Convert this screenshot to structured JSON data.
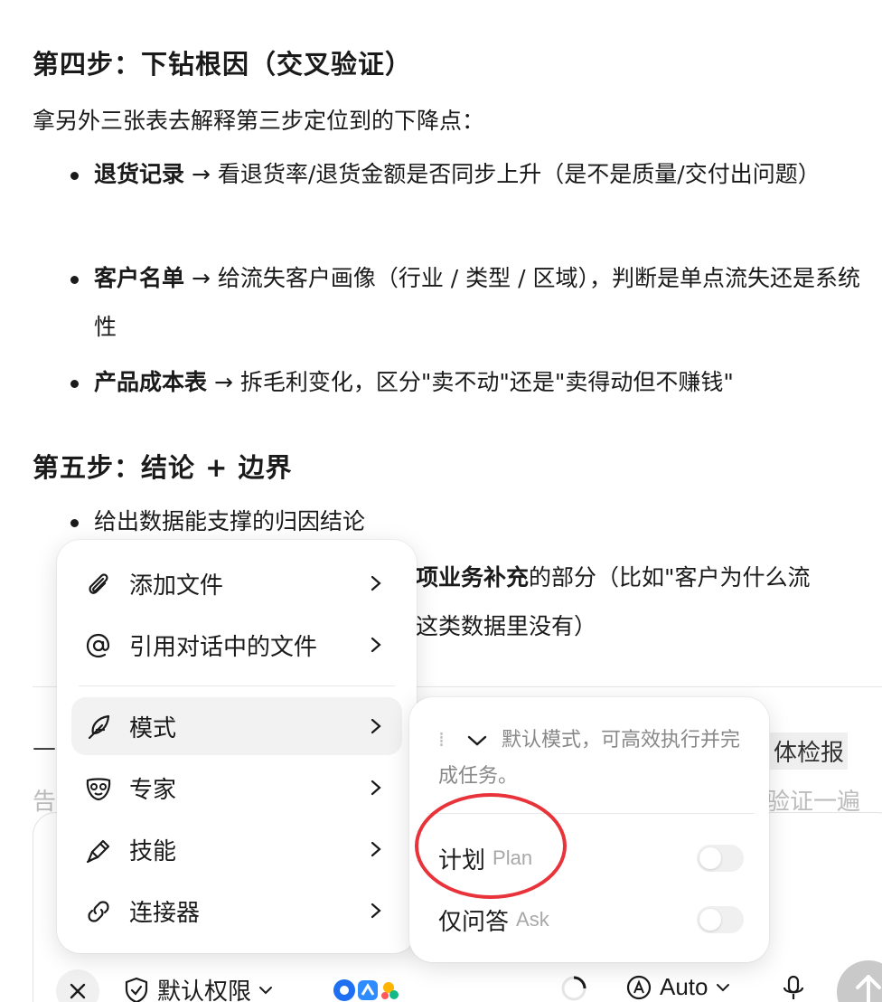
{
  "doc": {
    "step4_title": "第四步：下钻根因（交叉验证）",
    "step4_intro": "拿另外三张表去解释第三步定位到的下降点：",
    "step4_items": [
      {
        "bold": "退货记录",
        "text": " → 看退货率/退货金额是否同步上升（是不是质量/交付出问题）"
      },
      {
        "bold": "客户名单",
        "text": " → 给流失客户画像（行业 / 类型 / 区域），判断是单点流失还是系统性"
      },
      {
        "bold": "产品成本表",
        "text": " → 拆毛利变化，区分\"卖不动\"还是\"卖得动但不赚钱\""
      }
    ],
    "step5_title": "第五步：结论 + 边界",
    "step5_item1": "给出数据能支撑的归因结论",
    "step5_item2_bold": "项业务补充",
    "step5_item2_rest": "的部分（比如\"客户为什么流",
    "step5_item2_line2": "这类数据里没有）"
  },
  "background": {
    "dash": "—",
    "right_text": "体检报",
    "gray_left": "告",
    "gray_right": "验证一遍"
  },
  "menu": {
    "items": [
      {
        "label": "添加文件",
        "icon": "paperclip-icon"
      },
      {
        "label": "引用对话中的文件",
        "icon": "at-icon"
      },
      {
        "label": "模式",
        "icon": "feather-icon"
      },
      {
        "label": "专家",
        "icon": "expert-mask-icon"
      },
      {
        "label": "技能",
        "icon": "skill-pen-icon"
      },
      {
        "label": "连接器",
        "icon": "link-icon"
      }
    ]
  },
  "mode_submenu": {
    "description": "默认模式，可高效执行并完成任务。",
    "options": [
      {
        "label": "计划",
        "en": "Plan",
        "enabled": false
      },
      {
        "label": "仅问答",
        "en": "Ask",
        "enabled": false
      }
    ]
  },
  "bottom_bar": {
    "permission": "默认权限",
    "model": "Auto"
  },
  "colors": {
    "highlight_ring": "#e8333a",
    "active_item_bg": "#f2f2f2"
  }
}
